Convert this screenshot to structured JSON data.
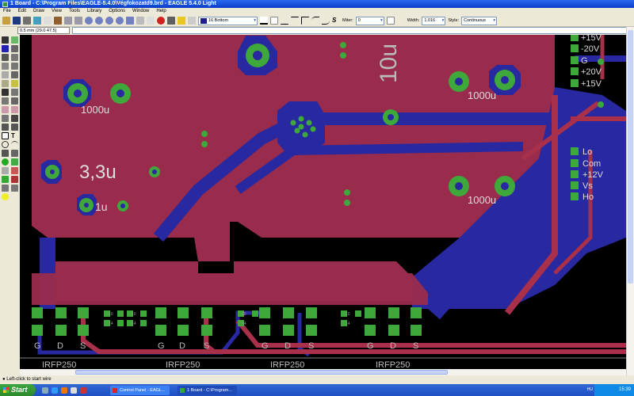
{
  "window": {
    "title": "1 Board - C:\\Program Files\\EAGLE-5.4.0\\Végfokozatd9.brd - EAGLE 5.4.0 Light"
  },
  "menu": [
    "File",
    "Edit",
    "Draw",
    "View",
    "Tools",
    "Library",
    "Options",
    "Window",
    "Help"
  ],
  "toolbar": {
    "layer": "16 Bottom",
    "layer_color": "#1e1e8c",
    "miter_label": "Miter:",
    "miter_value": "0",
    "width_label": "Width:",
    "width_value": "1.016",
    "style_label": "Style:",
    "style_value": "Continuous"
  },
  "coordinates": "0.5 mm (29.0 47.5)",
  "board": {
    "values": {
      "c1": "1000u",
      "c2": "1000u",
      "c3": "1000u",
      "c4": "3,3u",
      "c5": "1u",
      "c6": "10u"
    },
    "connectors_top": [
      "+15V",
      "-20V",
      "G",
      "+20V",
      "+15V"
    ],
    "connectors_bottom": [
      "Lo",
      "Com",
      "+12V",
      "Vs",
      "Ho"
    ],
    "pin_labels": [
      "G",
      "D",
      "S"
    ],
    "resistor_labels": [
      "10",
      "14"
    ],
    "transistor": "IRFP250",
    "colors": {
      "top": "#a02a48",
      "bottom": "#2828a0",
      "pad": "#3ea83a",
      "background": "#000000"
    }
  },
  "status": "Left-click to start wire",
  "taskbar": {
    "start": "Start",
    "tasks": [
      "Control Panel - EAGL...",
      "1 Board - C:\\Program..."
    ],
    "lang": "HU",
    "clock": "15:39"
  }
}
